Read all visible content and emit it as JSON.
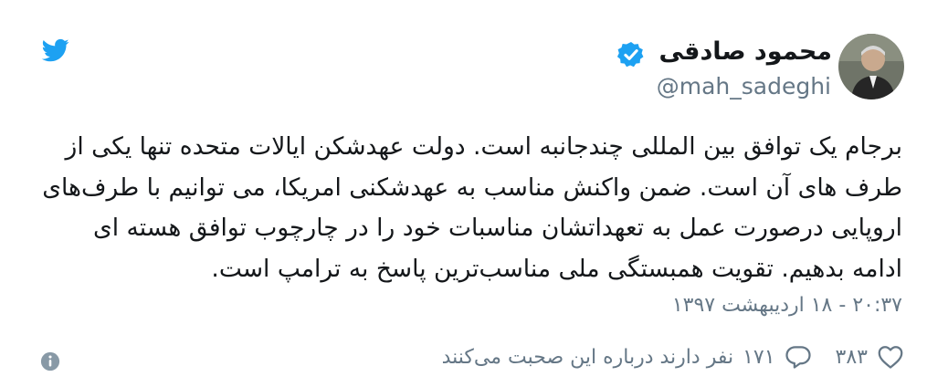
{
  "user": {
    "display_name": "محمود صادقی",
    "handle": "@mah_sadeghi",
    "verified": true
  },
  "tweet": {
    "text": "برجام یک توافق بین المللی چندجانبه است. دولت عهدشکن ایالات متحده تنها یکی از طرف های آن است. ضمن واکنش مناسب به عهدشکنی امریکا، می توانیم با طرف‌های اروپایی درصورت عمل به تعهداتشان مناسبات خود را در چارچوب توافق هسته ای ادامه بدهیم. تقویت همبستگی ملی مناسب‌ترین پاسخ به ترامپ است.",
    "timestamp": "۲۰:۳۷ - ۱۸ اردیبهشت ۱۳۹۷"
  },
  "actions": {
    "like_count": "۳۸۳",
    "reply_count": "۱۷۱",
    "reply_caption": "نفر دارند درباره این صحبت می‌کنند"
  },
  "icons": {
    "brand": "twitter-bird-icon",
    "verified": "verified-badge-icon",
    "like": "heart-icon",
    "reply": "speech-bubble-icon",
    "info": "info-icon"
  },
  "colors": {
    "brand_blue": "#1da1f2",
    "text": "#14171a",
    "secondary_text": "#657786"
  }
}
